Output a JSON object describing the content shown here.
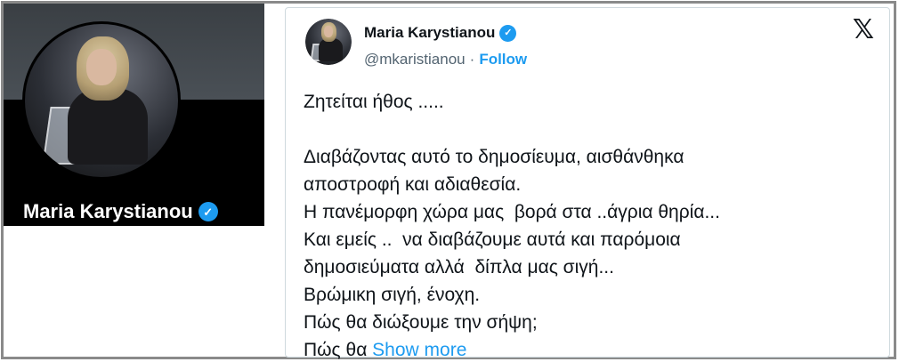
{
  "profile_card": {
    "name": "Maria Karystianou",
    "verified_icon": "verified-check-icon",
    "banner_color": "#3a3f44",
    "background": "#000000"
  },
  "tweet": {
    "author_name": "Maria Karystianou",
    "handle": "@mkaristianou",
    "separator": "·",
    "follow_label": "Follow",
    "logo_icon": "x-logo-icon",
    "accent_color": "#1d9bf0",
    "lines": [
      "Ζητείται ήθος .....",
      "",
      "Διαβάζοντας αυτό το δημοσίευμα, αισθάνθηκα",
      "αποστροφή και αδιαθεσία.",
      "Η πανέμορφη χώρα μας  βορά στα ..άγρια θηρία...",
      "Και εμείς ..  να διαβάζουμε αυτά και παρόμοια",
      "δημοσιεύματα αλλά  δίπλα μας σιγή...",
      "Βρώμικη σιγή, ένοχη.",
      "Πώς θα διώξουμε την σήψη;"
    ],
    "last_line_prefix": "Πώς θα ",
    "show_more_label": "Show more"
  }
}
